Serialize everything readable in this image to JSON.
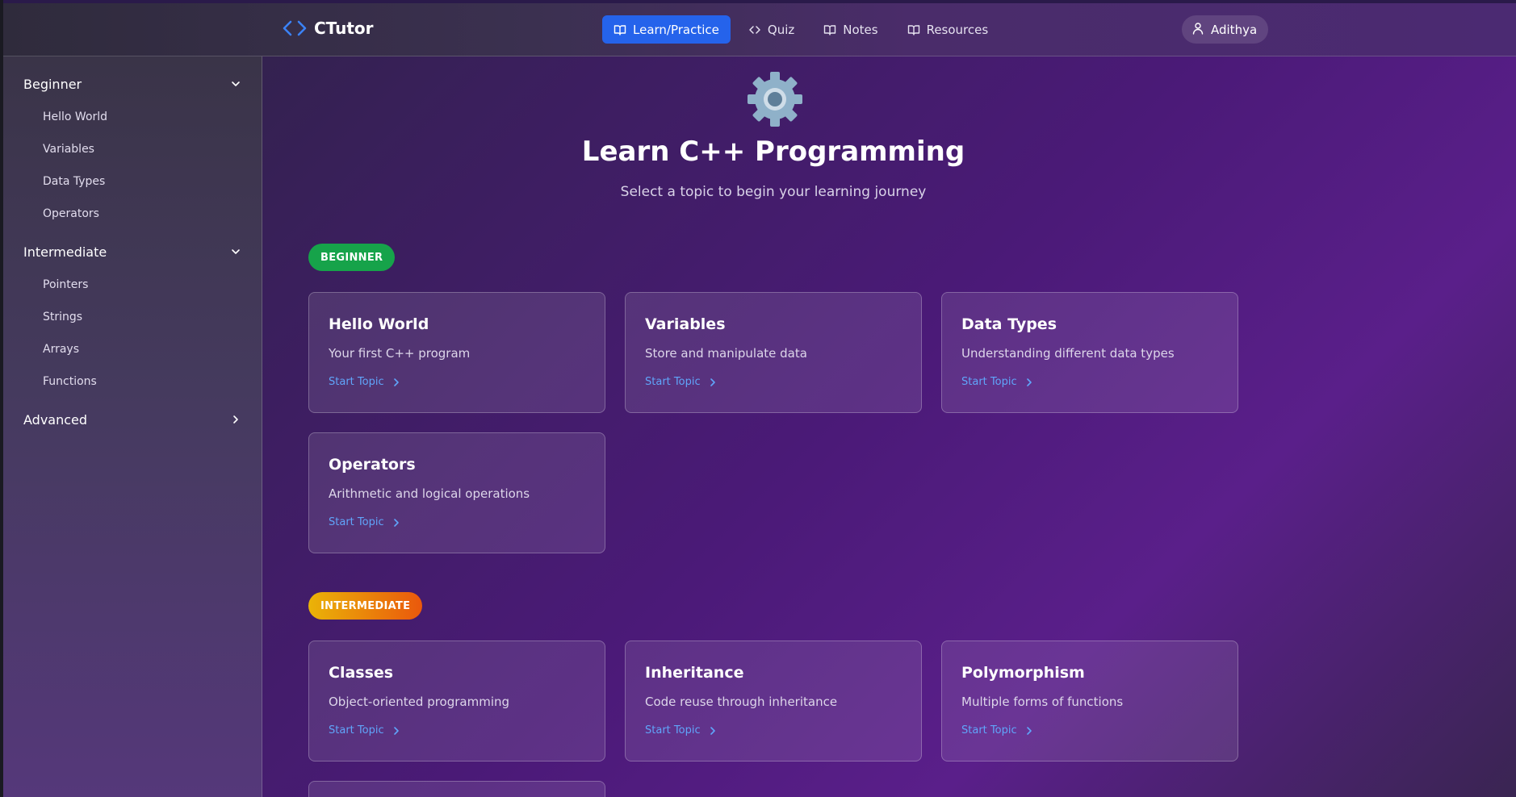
{
  "header": {
    "brand": "CTutor",
    "nav": [
      {
        "label": "Learn/Practice",
        "active": true
      },
      {
        "label": "Quiz"
      },
      {
        "label": "Notes"
      },
      {
        "label": "Resources"
      }
    ],
    "user": "Adithya"
  },
  "sidebar": {
    "sections": [
      {
        "label": "Beginner",
        "expanded": true,
        "items": [
          "Hello World",
          "Variables",
          "Data Types",
          "Operators"
        ]
      },
      {
        "label": "Intermediate",
        "expanded": true,
        "items": [
          "Pointers",
          "Strings",
          "Arrays",
          "Functions"
        ]
      },
      {
        "label": "Advanced",
        "expanded": false,
        "items": []
      }
    ]
  },
  "main": {
    "icon": "gear-icon",
    "title": "Learn C++ Programming",
    "subtitle": "Select a topic to begin your learning journey",
    "groups": [
      {
        "badge": "BEGINNER",
        "cards": [
          {
            "title": "Hello World",
            "desc": "Your first C++ program",
            "link": "Start Topic"
          },
          {
            "title": "Variables",
            "desc": "Store and manipulate data",
            "link": "Start Topic"
          },
          {
            "title": "Data Types",
            "desc": "Understanding different data types",
            "link": "Start Topic"
          },
          {
            "title": "Operators",
            "desc": "Arithmetic and logical operations",
            "link": "Start Topic"
          }
        ]
      },
      {
        "badge": "INTERMEDIATE",
        "cards": [
          {
            "title": "Classes",
            "desc": "Object-oriented programming",
            "link": "Start Topic"
          },
          {
            "title": "Inheritance",
            "desc": "Code reuse through inheritance",
            "link": "Start Topic"
          },
          {
            "title": "Polymorphism",
            "desc": "Multiple forms of functions",
            "link": "Start Topic"
          }
        ]
      }
    ]
  },
  "colors": {
    "accent": "#2563eb",
    "link": "#60a5fa",
    "beginner_badge": "#16a34a",
    "intermediate_badge": "#ea580c"
  }
}
